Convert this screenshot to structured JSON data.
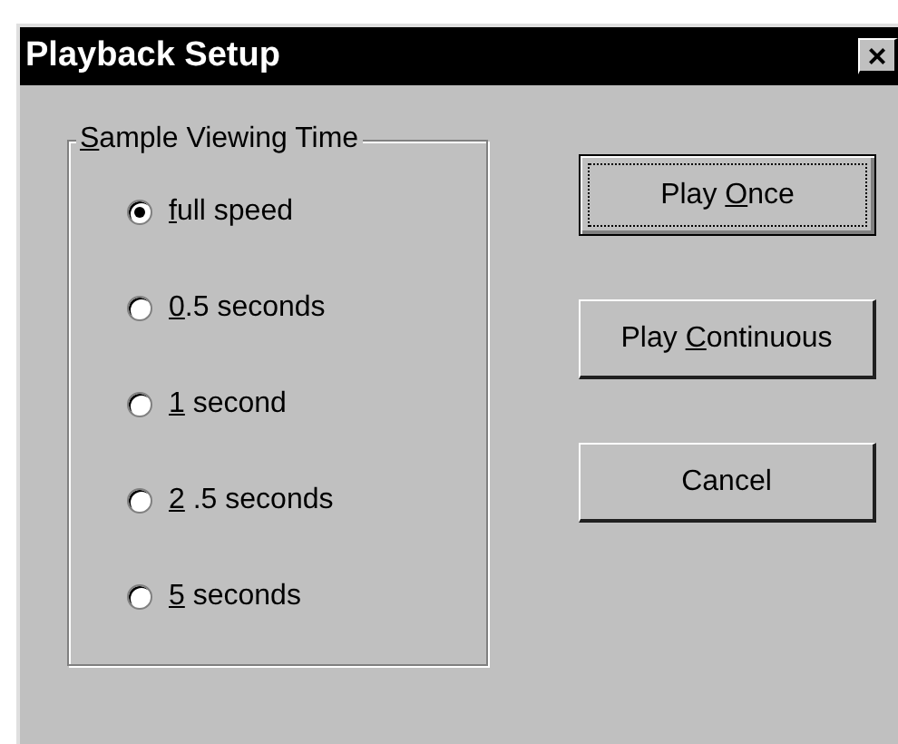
{
  "window": {
    "title": "Playback Setup",
    "close": "×"
  },
  "group": {
    "label": {
      "access_key": "S",
      "after": "ample Viewing Time"
    }
  },
  "options": [
    {
      "label": {
        "access_key": "f",
        "after": "ull speed"
      },
      "selected": true
    },
    {
      "label": {
        "access_key": "0",
        "after": ".5 seconds"
      },
      "selected": false
    },
    {
      "label": {
        "access_key": "1",
        "after": " second"
      },
      "selected": false
    },
    {
      "label": {
        "access_key": "2",
        "after": " .5 seconds"
      },
      "selected": false
    },
    {
      "label": {
        "access_key": "5",
        "after": " seconds"
      },
      "selected": false
    }
  ],
  "buttons": [
    {
      "label": {
        "before": "Play ",
        "access_key": "O",
        "after": "nce"
      },
      "default": true
    },
    {
      "label": {
        "before": "Play ",
        "access_key": "C",
        "after": "ontinuous"
      },
      "default": false
    },
    {
      "label": {
        "before": "Cancel"
      },
      "default": false
    }
  ]
}
